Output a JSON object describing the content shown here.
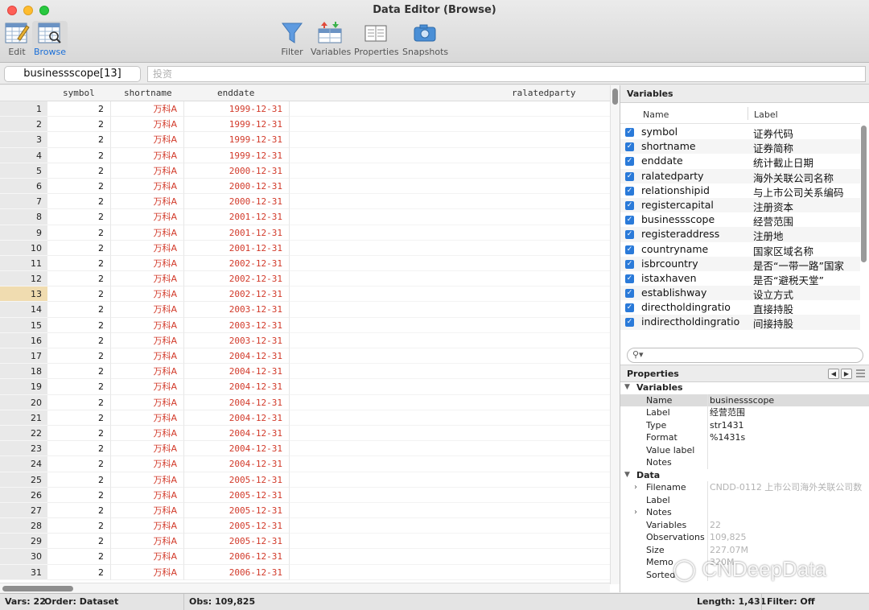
{
  "window": {
    "title": "Data Editor (Browse)"
  },
  "toolbar": {
    "edit": "Edit",
    "browse": "Browse",
    "filter": "Filter",
    "variables": "Variables",
    "properties": "Properties",
    "snapshots": "Snapshots"
  },
  "editbar": {
    "varname": "businessscope[13]",
    "value_placeholder": "投资"
  },
  "grid": {
    "columns": [
      "symbol",
      "shortname",
      "enddate",
      "ralatedparty"
    ],
    "selected_row": 13,
    "rows": [
      [
        "1",
        "2",
        "万科A",
        "1999-12-31"
      ],
      [
        "2",
        "2",
        "万科A",
        "1999-12-31"
      ],
      [
        "3",
        "2",
        "万科A",
        "1999-12-31"
      ],
      [
        "4",
        "2",
        "万科A",
        "1999-12-31"
      ],
      [
        "5",
        "2",
        "万科A",
        "2000-12-31"
      ],
      [
        "6",
        "2",
        "万科A",
        "2000-12-31"
      ],
      [
        "7",
        "2",
        "万科A",
        "2000-12-31"
      ],
      [
        "8",
        "2",
        "万科A",
        "2001-12-31"
      ],
      [
        "9",
        "2",
        "万科A",
        "2001-12-31"
      ],
      [
        "10",
        "2",
        "万科A",
        "2001-12-31"
      ],
      [
        "11",
        "2",
        "万科A",
        "2002-12-31"
      ],
      [
        "12",
        "2",
        "万科A",
        "2002-12-31"
      ],
      [
        "13",
        "2",
        "万科A",
        "2002-12-31"
      ],
      [
        "14",
        "2",
        "万科A",
        "2003-12-31"
      ],
      [
        "15",
        "2",
        "万科A",
        "2003-12-31"
      ],
      [
        "16",
        "2",
        "万科A",
        "2003-12-31"
      ],
      [
        "17",
        "2",
        "万科A",
        "2004-12-31"
      ],
      [
        "18",
        "2",
        "万科A",
        "2004-12-31"
      ],
      [
        "19",
        "2",
        "万科A",
        "2004-12-31"
      ],
      [
        "20",
        "2",
        "万科A",
        "2004-12-31"
      ],
      [
        "21",
        "2",
        "万科A",
        "2004-12-31"
      ],
      [
        "22",
        "2",
        "万科A",
        "2004-12-31"
      ],
      [
        "23",
        "2",
        "万科A",
        "2004-12-31"
      ],
      [
        "24",
        "2",
        "万科A",
        "2004-12-31"
      ],
      [
        "25",
        "2",
        "万科A",
        "2005-12-31"
      ],
      [
        "26",
        "2",
        "万科A",
        "2005-12-31"
      ],
      [
        "27",
        "2",
        "万科A",
        "2005-12-31"
      ],
      [
        "28",
        "2",
        "万科A",
        "2005-12-31"
      ],
      [
        "29",
        "2",
        "万科A",
        "2005-12-31"
      ],
      [
        "30",
        "2",
        "万科A",
        "2006-12-31"
      ],
      [
        "31",
        "2",
        "万科A",
        "2006-12-31"
      ]
    ]
  },
  "variables_panel": {
    "title": "Variables",
    "col_name": "Name",
    "col_label": "Label",
    "items": [
      {
        "name": "symbol",
        "label": "证券代码"
      },
      {
        "name": "shortname",
        "label": "证券简称"
      },
      {
        "name": "enddate",
        "label": "统计截止日期"
      },
      {
        "name": "ralatedparty",
        "label": "海外关联公司名称"
      },
      {
        "name": "relationshipid",
        "label": "与上市公司关系编码"
      },
      {
        "name": "registercapital",
        "label": "注册资本"
      },
      {
        "name": "businessscope",
        "label": "经营范围"
      },
      {
        "name": "registeraddress",
        "label": "注册地"
      },
      {
        "name": "countryname",
        "label": "国家区域名称"
      },
      {
        "name": "isbrcountry",
        "label": "是否“一带一路”国家"
      },
      {
        "name": "istaxhaven",
        "label": "是否“避税天堂”"
      },
      {
        "name": "establishway",
        "label": "设立方式"
      },
      {
        "name": "directholdingratio",
        "label": "直接持股"
      },
      {
        "name": "indirectholdingratio",
        "label": "间接持股"
      }
    ]
  },
  "properties_panel": {
    "title": "Properties",
    "variables_section": "Variables",
    "var_rows": [
      {
        "key": "Name",
        "value": "businessscope"
      },
      {
        "key": "Label",
        "value": "经营范围"
      },
      {
        "key": "Type",
        "value": "str1431"
      },
      {
        "key": "Format",
        "value": "%1431s"
      },
      {
        "key": "Value label",
        "value": ""
      },
      {
        "key": "Notes",
        "value": ""
      }
    ],
    "data_section": "Data",
    "data_rows": [
      {
        "key": "Filename",
        "value": "CNDD-0112 上市公司海外关联公司数"
      },
      {
        "key": "Label",
        "value": ""
      },
      {
        "key": "Notes",
        "value": ""
      },
      {
        "key": "Variables",
        "value": "22"
      },
      {
        "key": "Observations",
        "value": "109,825"
      },
      {
        "key": "Size",
        "value": "227.07M"
      },
      {
        "key": "Memo",
        "value": "320M"
      },
      {
        "key": "Sorted",
        "value": ""
      }
    ]
  },
  "watermark": "CNDeepData",
  "status": {
    "vars": "Vars: 22",
    "order": "Order: Dataset",
    "obs": "Obs: 109,825",
    "length": "Length: 1,431",
    "filter": "Filter: Off"
  }
}
